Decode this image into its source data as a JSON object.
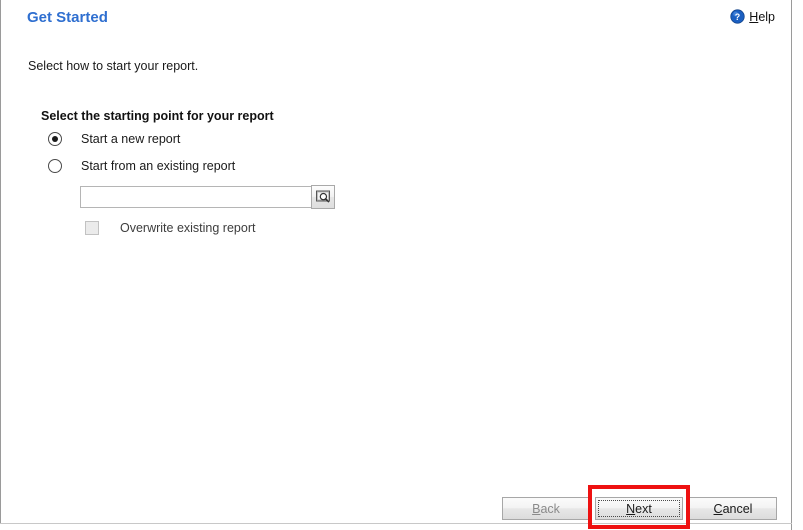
{
  "window": {
    "title": "Get Started"
  },
  "header": {
    "title": "Get Started",
    "help": {
      "icon": "help-circle-icon",
      "accel": "H",
      "rest": "elp",
      "full_label": "Help"
    }
  },
  "main": {
    "instruction": "Select how to start your report.",
    "group_label": "Select the starting point for your report",
    "options": [
      {
        "label": "Start a new report",
        "selected": true
      },
      {
        "label": "Start from an existing report",
        "selected": false
      }
    ],
    "existing_report_field": {
      "value": "",
      "placeholder": "",
      "browse_icon": "browse-magnifier-icon"
    },
    "overwrite_checkbox": {
      "label": "Overwrite existing report",
      "checked": false,
      "enabled": false
    }
  },
  "footer": {
    "buttons": [
      {
        "name": "back",
        "accel": "B",
        "rest": "ack",
        "full_label": "Back",
        "enabled": false,
        "focused": false
      },
      {
        "name": "next",
        "accel": "N",
        "rest": "ext",
        "full_label": "Next",
        "enabled": true,
        "focused": true
      },
      {
        "name": "cancel",
        "accel": "C",
        "rest": "ancel",
        "full_label": "Cancel",
        "enabled": true,
        "focused": false
      }
    ]
  },
  "annotation": {
    "highlight_color": "#ee1111",
    "target": "next-button"
  }
}
